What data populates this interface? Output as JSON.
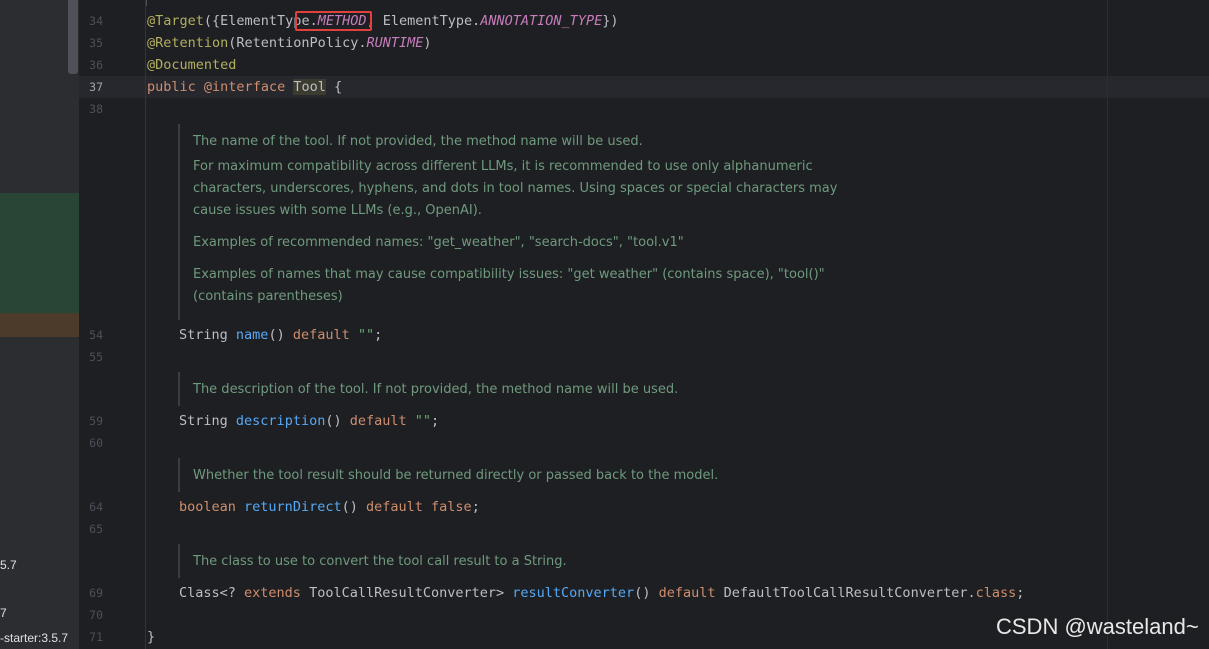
{
  "left_panel": {
    "text_1": "5.7",
    "text_2": "7",
    "text_3": "-starter:3.5.7"
  },
  "gutter": {
    "l34": "34",
    "l35": "35",
    "l36": "36",
    "l37": "37",
    "l38": "38",
    "l54": "54",
    "l55": "55",
    "l59": "59",
    "l60": "60",
    "l64": "64",
    "l65": "65",
    "l69": "69",
    "l70": "70",
    "l71": "71"
  },
  "code": {
    "line34": {
      "ann": "@Target",
      "open": "({ElementType.",
      "method": "METHOD",
      "mid": ", ElementType.",
      "annotation_type": "ANNOTATION_TYPE",
      "close": "})"
    },
    "line35": {
      "ann": "@Retention",
      "open": "(RetentionPolicy.",
      "runtime": "RUNTIME",
      "close": ")"
    },
    "line36": {
      "ann": "@Documented"
    },
    "line37": {
      "kw_public": "public",
      "kw_interface": "@interface",
      "type_name": "Tool",
      "brace": "{"
    },
    "line54": {
      "type": "String",
      "method": "name",
      "parens": "()",
      "kw_default": "default",
      "value": "\"\"",
      "semi": ";"
    },
    "line59": {
      "type": "String",
      "method": "description",
      "parens": "()",
      "kw_default": "default",
      "value": "\"\"",
      "semi": ";"
    },
    "line64": {
      "type": "boolean",
      "method": "returnDirect",
      "parens": "()",
      "kw_default": "default",
      "value": "false",
      "semi": ";"
    },
    "line69": {
      "type_pre": "Class<? ",
      "kw_extends": "extends",
      "type_post": " ToolCallResultConverter> ",
      "method": "resultConverter",
      "parens": "()",
      "kw_default": "default",
      "value_cls": " DefaultToolCallResultConverter.",
      "kw_class": "class",
      "semi": ";"
    },
    "line71": {
      "brace": "}"
    }
  },
  "docs": {
    "name_doc": [
      "The name of the tool. If not provided, the method name will be used.",
      "For maximum compatibility across different LLMs, it is recommended to use only alphanumeric",
      "characters, underscores, hyphens, and dots in tool names. Using spaces or special characters may",
      "cause issues with some LLMs (e.g., OpenAI).",
      "Examples of recommended names: \"get_weather\", \"search-docs\", \"tool.v1\"",
      "Examples of names that may cause compatibility issues: \"get weather\" (contains space), \"tool()\"",
      "(contains parentheses)"
    ],
    "description_doc": "The description of the tool. If not provided, the method name will be used.",
    "return_direct_doc": "Whether the tool result should be returned directly or passed back to the model.",
    "result_converter_doc": "The class to use to convert the tool call result to a String."
  },
  "watermark": "CSDN @wasteland~",
  "colors": {
    "background": "#1e1f22",
    "annotation": "#b3ae60",
    "keyword": "#cf8e6d",
    "constant": "#c77dbb",
    "method": "#56a8f5",
    "string": "#6aab73",
    "doc_text": "#6f9a7e",
    "highlight_box": "#e0413f"
  }
}
